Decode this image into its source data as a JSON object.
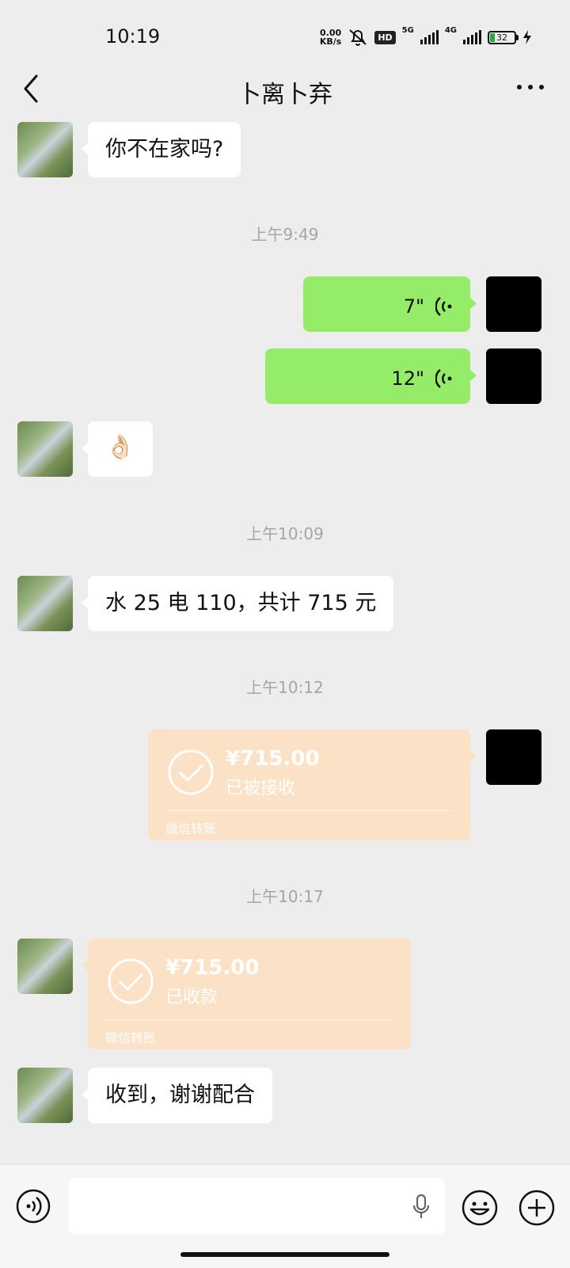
{
  "status": {
    "time": "10:19",
    "net_speed_value": "0.00",
    "net_speed_unit": "KB/s",
    "hd_label": "HD",
    "sim1_label": "5G",
    "sim2_label": "4G",
    "battery_level": "32"
  },
  "header": {
    "title": "卜离卜弃"
  },
  "messages": {
    "m1_text": "你不在家吗?",
    "ts1": "上午9:49",
    "voice1_duration": "7\"",
    "voice2_duration": "12\"",
    "m2_emoji": "👌🏻",
    "ts2": "上午10:09",
    "m3_text": "水 25 电 110，共计 715 元",
    "ts3": "上午10:12",
    "transfer1": {
      "amount": "¥715.00",
      "status": "已被接收",
      "footer": "微信转账"
    },
    "ts4": "上午10:17",
    "transfer2": {
      "amount": "¥715.00",
      "status": "已收款",
      "footer": "微信转账"
    },
    "m4_text": "收到，谢谢配合"
  },
  "colors": {
    "background": "#ededed",
    "voice_bubble": "#95ec69",
    "transfer_bubble": "#fbe2c6",
    "battery_fill": "#2ca73b"
  }
}
